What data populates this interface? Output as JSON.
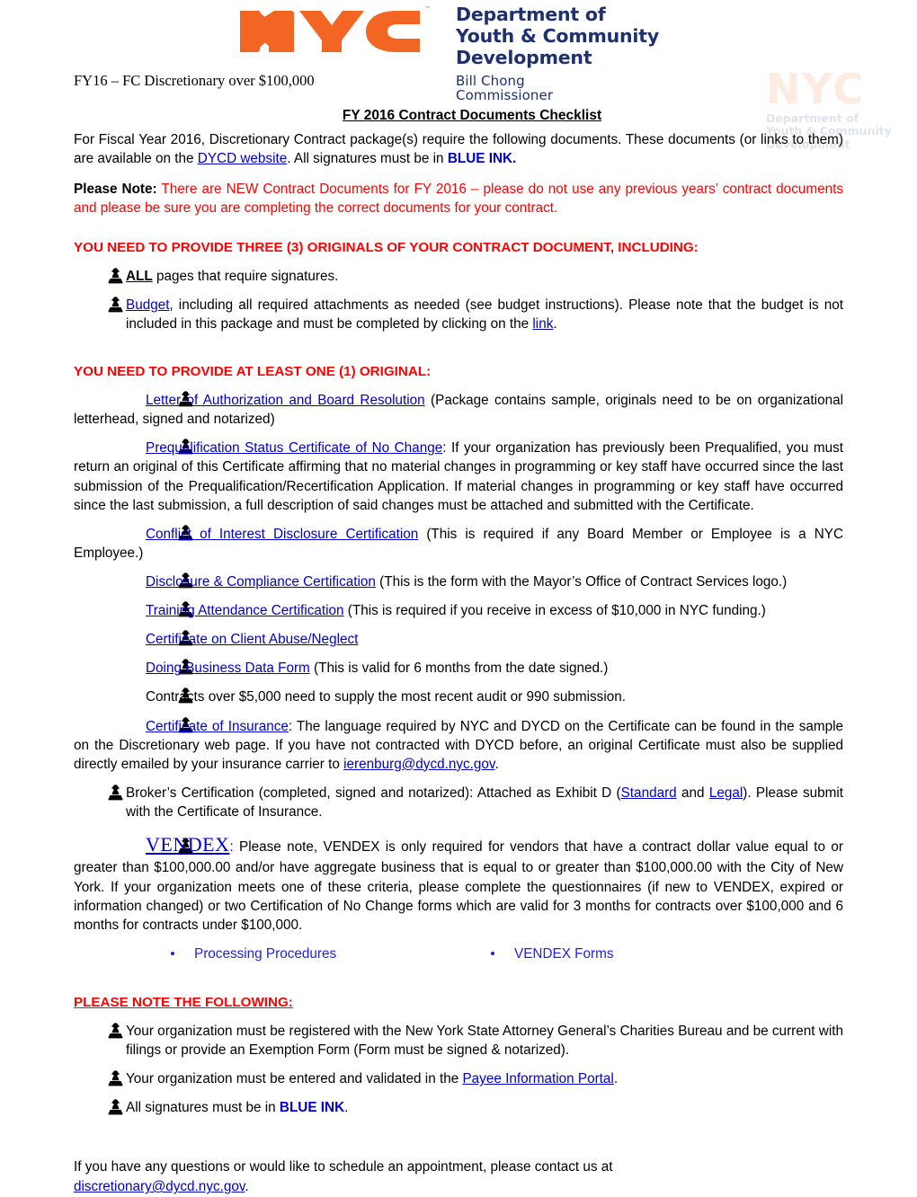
{
  "colors": {
    "nyc_orange": "#F26522",
    "dycd_navy": "#1F3070",
    "alert_red": "#FF0000",
    "link_blue": "#0000CC"
  },
  "header": {
    "logo_text": "NYC",
    "trademark": "™",
    "department_line1": "Department of",
    "department_line2": "Youth & Community",
    "department_line3": "Development",
    "commissioner_name": "Bill Chong",
    "commissioner_title": "Commissioner",
    "fy_label": "FY16 – FC Discretionary over $100,000"
  },
  "watermark": {
    "logo_text": "NYC",
    "line1": "Department of",
    "line2": "Youth & Community",
    "line3": "Development"
  },
  "document": {
    "title": "FY 2016 Contract Documents Checklist",
    "intro_a": "For Fiscal Year 2016, Discretionary Contract package(s) require the following documents. These documents (or links to them) are available on the ",
    "intro_link": "DYCD website",
    "intro_b": ".  All signatures must be in ",
    "intro_blue_ink": "BLUE INK.",
    "note_label": "Please Note:",
    "note_text": " There are NEW Contract Documents for FY 2016 – please do not use any previous years’ contract documents and please be sure you are completing the correct documents for your contract."
  },
  "section_three_originals": {
    "heading": "YOU NEED TO PROVIDE THREE (3) ORIGINALS OF YOUR CONTRACT DOCUMENT, INCLUDING:",
    "items": [
      {
        "bold_underline": "ALL",
        "text_after": " pages that require signatures."
      },
      {
        "link": "Budget",
        "text_after": ", including all required attachments as needed (see budget instructions).  Please note that the budget is not included in this package and must be completed by clicking on the ",
        "link2": "link",
        "text_end": "."
      }
    ]
  },
  "section_one_original": {
    "heading": "YOU NEED TO PROVIDE AT LEAST ONE (1) ORIGINAL:",
    "items": [
      {
        "link": "Letter of Authorization and Board Resolution",
        "text_after": " (Package contains sample, originals need to be on organizational letterhead, signed and notarized)"
      },
      {
        "link": "Prequalification Status Certificate of No Change",
        "text_after": ": If your organization has previously been Prequalified, you must return an original of this Certificate affirming that no material changes in programming or key staff have occurred since the last submission of the Prequalification/Recertification Application. If material changes in programming or key staff have occurred since the last submission, a full description of said changes must be attached and submitted with the Certificate."
      },
      {
        "link": "Conflict of Interest Disclosure Certification",
        "text_after": " (This is required if any Board Member or Employee is a NYC Employee.)"
      },
      {
        "link": "Disclosure & Compliance Certification",
        "text_after": " (This is the form with the Mayor’s Office of Contract Services logo.)"
      },
      {
        "link": "Training Attendance Certification",
        "text_after": " (This is required if you receive in excess of $10,000 in NYC funding.)"
      },
      {
        "link": "Certificate on Client Abuse/Neglect",
        "text_after": ""
      },
      {
        "link": "Doing Business Data Form",
        "text_after": " (This is valid for 6 months from the date signed.)"
      },
      {
        "link": "",
        "text_after": "Contracts over $5,000 need to supply the most recent audit or 990 submission."
      },
      {
        "link": "Certificate of Insurance",
        "text_after": ": The language required by NYC and DYCD on the Certificate can be found in the sample on the Discretionary web page. If you have not contracted with DYCD before, an original Certificate must also be supplied directly emailed by your insurance carrier to ",
        "email": "ierenburg@dycd.nyc.gov",
        "text_end": "."
      }
    ],
    "broker": {
      "text_a": "Broker’s Certification (completed, signed and notarized): Attached as Exhibit D (",
      "link1": "Standard",
      "text_mid": " and ",
      "link2": "Legal",
      "text_b": ").  Please submit with the Certificate of Insurance."
    },
    "vendex": {
      "word": "VENDEX",
      "colon": ":",
      "text": " Please note, VENDEX is only required for vendors that have a contract dollar value equal to or greater than $100,000.00 and/or have aggregate business that is equal to or greater than $100,000.00 with the City of New York.  If your organization meets one of these criteria, please complete the questionnaires (if new to VENDEX, expired or information changed) or two Certification of No Change forms which are valid for 3 months for contracts over $100,000 and 6 months for contracts under $100,000.",
      "sublinks": [
        "Processing Procedures",
        "VENDEX Forms"
      ]
    }
  },
  "section_please_note": {
    "heading": "PLEASE NOTE THE FOLLOWING:",
    "items": [
      {
        "text": "Your organization must be registered with the New York State Attorney General’s Charities Bureau and be current with filings or provide an Exemption Form (Form must be signed & notarized)."
      },
      {
        "text_a": "Your organization must be entered and validated in the ",
        "link": "Payee Information Portal",
        "text_b": "."
      },
      {
        "text_a": "All signatures must be in ",
        "bold_blue": "BLUE INK",
        "text_b": "."
      }
    ]
  },
  "footer": {
    "text": "If you have any questions or would like to schedule an appointment, please contact us at ",
    "email": "discretionary@dycd.nyc.gov",
    "period": "."
  }
}
